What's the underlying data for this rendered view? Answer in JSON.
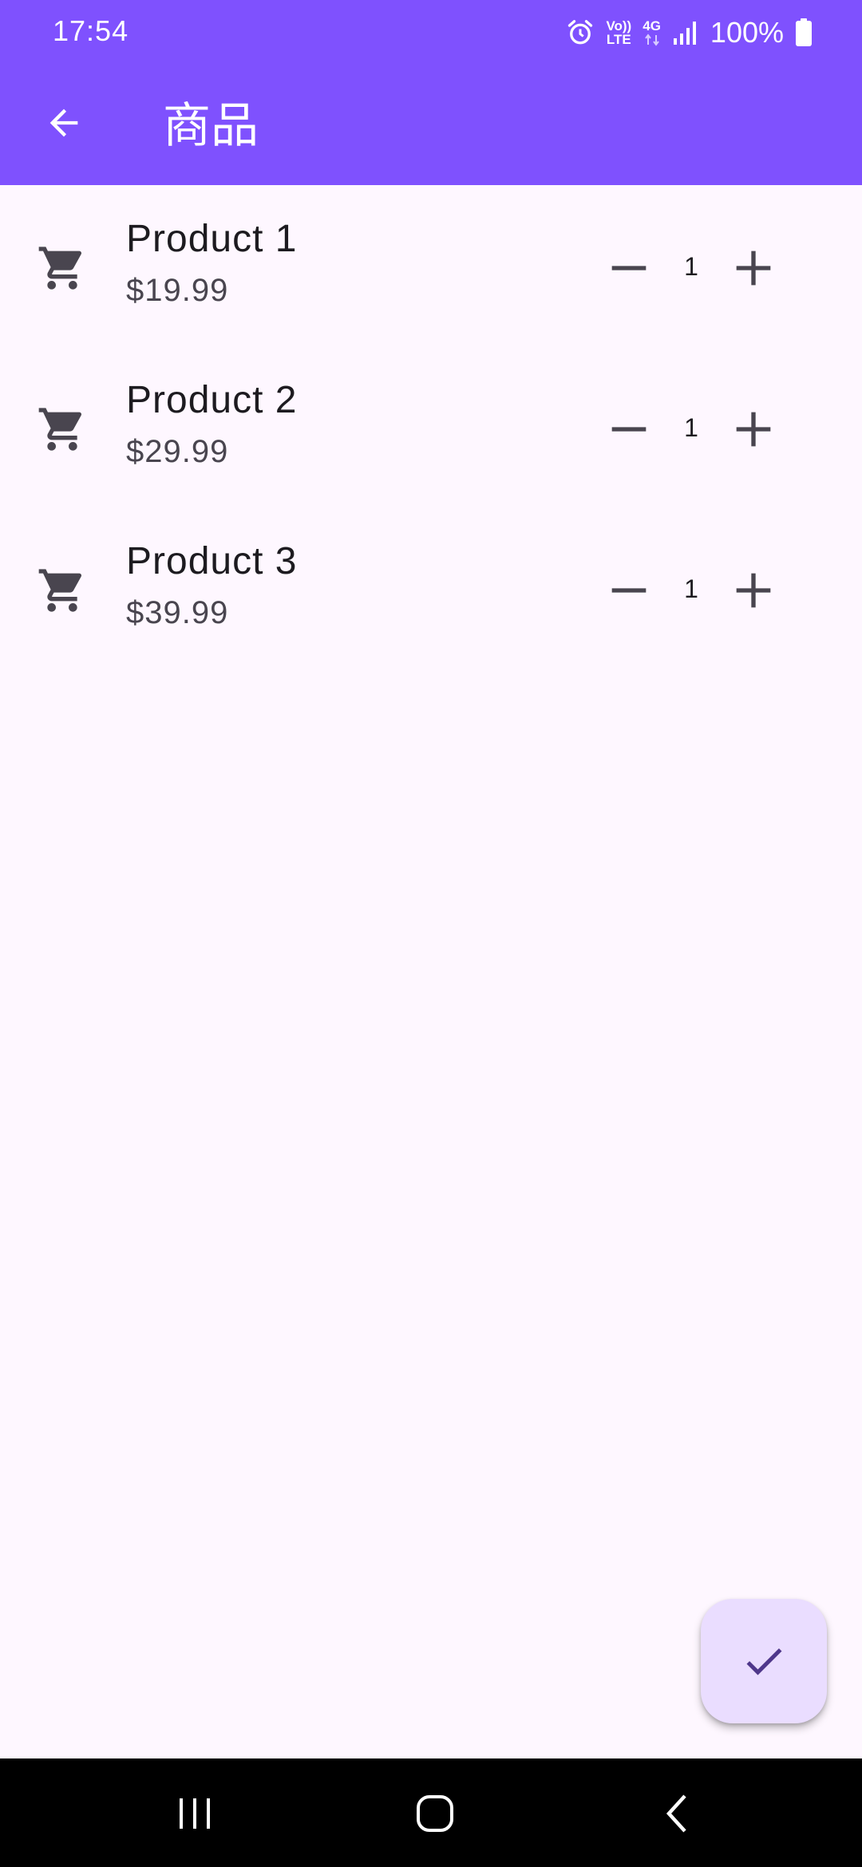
{
  "status_bar": {
    "time": "17:54",
    "battery_percent": "100%",
    "icons": [
      "alarm-icon",
      "volte-icon",
      "4g-data-icon",
      "signal-icon",
      "battery-icon"
    ],
    "volte_top": "Vo))",
    "volte_bottom": "LTE",
    "network": "4G"
  },
  "app_bar": {
    "title": "商品",
    "back_icon": "arrow-back-icon",
    "background": "#7f51fe"
  },
  "products": [
    {
      "name": "Product 1",
      "price": "$19.99",
      "quantity": "1"
    },
    {
      "name": "Product 2",
      "price": "$29.99",
      "quantity": "1"
    },
    {
      "name": "Product 3",
      "price": "$39.99",
      "quantity": "1"
    }
  ],
  "icons": {
    "product_icon": "shopping-cart-icon",
    "decrement_icon": "minus-icon",
    "increment_icon": "plus-icon"
  },
  "fab": {
    "icon": "check-icon",
    "background": "#eaddff"
  },
  "nav_bar": {
    "buttons": [
      "recent-apps-icon",
      "home-icon",
      "back-icon"
    ]
  },
  "colors": {
    "page_background": "#fef7ff",
    "accent": "#7f51fe",
    "text_primary": "#1d1b20",
    "text_secondary": "#49454f"
  }
}
